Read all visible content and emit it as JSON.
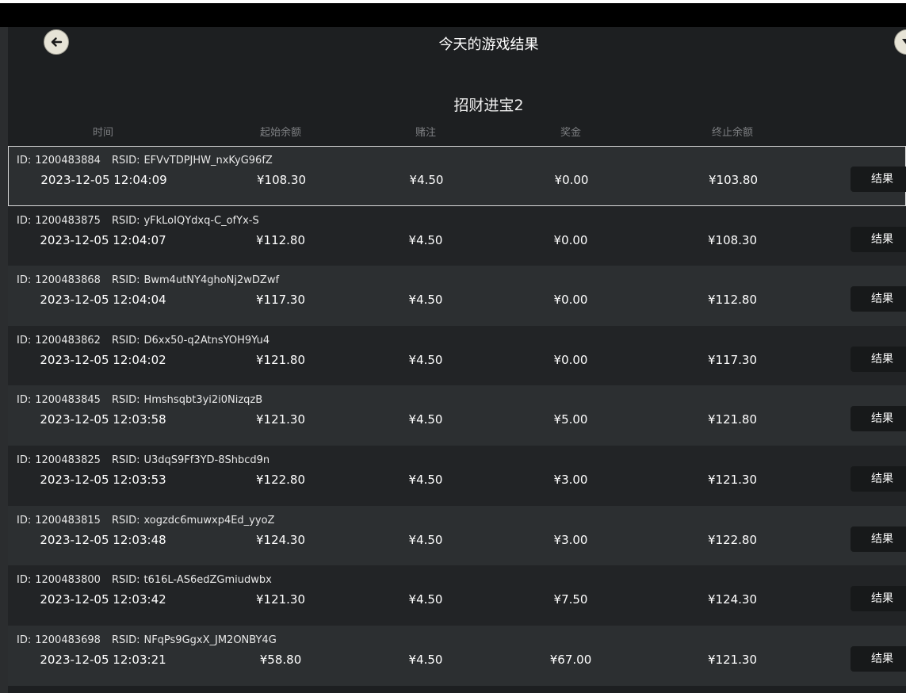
{
  "header": {
    "title": "今天的游戏结果",
    "back_icon": "arrow-left-icon",
    "right_icon": "chevron-down-icon"
  },
  "game": {
    "name": "招财进宝2"
  },
  "columns": {
    "time": "时间",
    "start_balance": "起始余额",
    "bet": "赌注",
    "prize": "奖金",
    "end_balance": "终止余额"
  },
  "labels": {
    "id": "ID:",
    "rsid": "RSID:",
    "result_button": "结果"
  },
  "rows": [
    {
      "id": "1200483884",
      "rsid": "EFVvTDPJHW_nxKyG96fZ",
      "time": "2023-12-05 12:04:09",
      "start": "¥108.30",
      "bet": "¥4.50",
      "prize": "¥0.00",
      "end": "¥103.80"
    },
    {
      "id": "1200483875",
      "rsid": "yFkLoIQYdxq-C_ofYx-S",
      "time": "2023-12-05 12:04:07",
      "start": "¥112.80",
      "bet": "¥4.50",
      "prize": "¥0.00",
      "end": "¥108.30"
    },
    {
      "id": "1200483868",
      "rsid": "Bwm4utNY4ghoNj2wDZwf",
      "time": "2023-12-05 12:04:04",
      "start": "¥117.30",
      "bet": "¥4.50",
      "prize": "¥0.00",
      "end": "¥112.80"
    },
    {
      "id": "1200483862",
      "rsid": "D6xx50-q2AtnsYOH9Yu4",
      "time": "2023-12-05 12:04:02",
      "start": "¥121.80",
      "bet": "¥4.50",
      "prize": "¥0.00",
      "end": "¥117.30"
    },
    {
      "id": "1200483845",
      "rsid": "Hmshsqbt3yi2i0NizqzB",
      "time": "2023-12-05 12:03:58",
      "start": "¥121.30",
      "bet": "¥4.50",
      "prize": "¥5.00",
      "end": "¥121.80"
    },
    {
      "id": "1200483825",
      "rsid": "U3dqS9Ff3YD-8Shbcd9n",
      "time": "2023-12-05 12:03:53",
      "start": "¥122.80",
      "bet": "¥4.50",
      "prize": "¥3.00",
      "end": "¥121.30"
    },
    {
      "id": "1200483815",
      "rsid": "xogzdc6muwxp4Ed_yyoZ",
      "time": "2023-12-05 12:03:48",
      "start": "¥124.30",
      "bet": "¥4.50",
      "prize": "¥3.00",
      "end": "¥122.80"
    },
    {
      "id": "1200483800",
      "rsid": "t616L-AS6edZGmiudwbx",
      "time": "2023-12-05 12:03:42",
      "start": "¥121.30",
      "bet": "¥4.50",
      "prize": "¥7.50",
      "end": "¥124.30"
    },
    {
      "id": "1200483698",
      "rsid": "NFqPs9GgxX_JM2ONBY4G",
      "time": "2023-12-05 12:03:21",
      "start": "¥58.80",
      "bet": "¥4.50",
      "prize": "¥67.00",
      "end": "¥121.30"
    }
  ]
}
